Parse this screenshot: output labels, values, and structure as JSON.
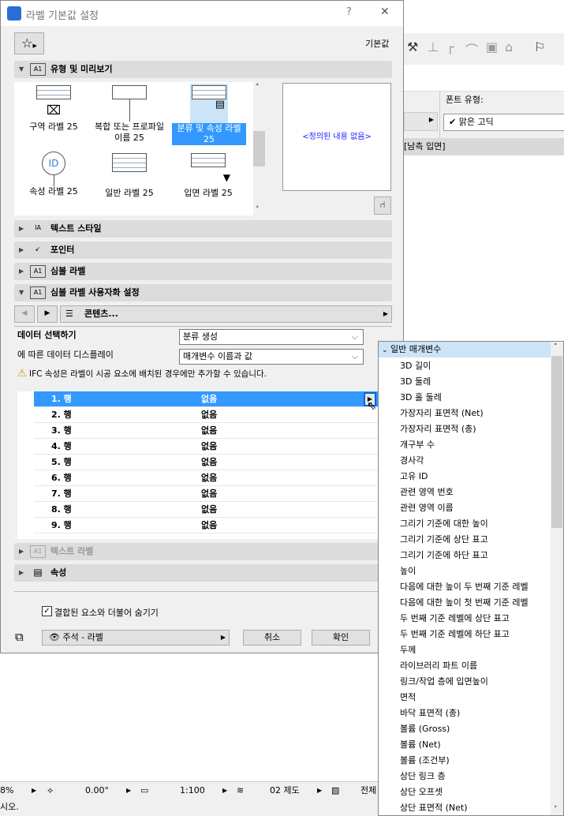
{
  "dialog": {
    "title": "라벨 기본값 설정",
    "help": "?",
    "close": "✕",
    "default_label": "기본값"
  },
  "sections": {
    "type_preview": "유형 및 미리보기",
    "text_style": "텍스트 스타일",
    "pointer": "포인터",
    "symbol_label": "심볼 라벨",
    "symbol_custom": "심볼 라벨 사용자화 설정",
    "text_label": "텍스트 라벨",
    "properties": "속성"
  },
  "label_types": [
    {
      "label": "구역 라벨 25"
    },
    {
      "label": "복합 또는 프로파일 이름 25"
    },
    {
      "label": "분류 및 속성 라벨 25",
      "selected": true
    },
    {
      "label": "속성 라벨 25"
    },
    {
      "label": "일반 라벨 25"
    },
    {
      "label": "입면 라벨 25"
    }
  ],
  "preview": {
    "empty": "<정의된 내용 없음>"
  },
  "nav": {
    "content": "콘텐츠..."
  },
  "data_select": {
    "label": "데이터 선택하기",
    "value": "분류 생성"
  },
  "data_display": {
    "label": "에 따른 데이터 디스플레이",
    "value": "매개변수 이름과 값"
  },
  "warning": "IFC 속성은 라벨이 시공 요소에 배치된 경우에만 추가할 수 있습니다.",
  "rows": [
    {
      "n": "1. 행",
      "v": "없음"
    },
    {
      "n": "2. 행",
      "v": "없음"
    },
    {
      "n": "3. 행",
      "v": "없음"
    },
    {
      "n": "4. 행",
      "v": "없음"
    },
    {
      "n": "5. 행",
      "v": "없음"
    },
    {
      "n": "6. 행",
      "v": "없음"
    },
    {
      "n": "7. 행",
      "v": "없음"
    },
    {
      "n": "8. 행",
      "v": "없음"
    },
    {
      "n": "9. 행",
      "v": "없음"
    }
  ],
  "footer": {
    "hide_checkbox": "결합된 요소와 더불어 숨기기",
    "layer": "주석 - 라벨",
    "cancel": "취소",
    "ok": "확인"
  },
  "background": {
    "font_type_label": "폰트 유형:",
    "font_value": "맑은 고딕",
    "view_name": "[남측 입면]"
  },
  "status": {
    "zoom": "8%",
    "angle": "0.00°",
    "scale": "1:100",
    "layer_combo": "02 제도",
    "all": "전체",
    "hint": "시오."
  },
  "param_list": {
    "header": "일반 매개변수",
    "items": [
      "3D 길이",
      "3D 둘레",
      "3D 홀 둘레",
      "가장자리 표면적 (Net)",
      "가장자리 표면적 (총)",
      "개구부 수",
      "경사각",
      "고유 ID",
      "관련 영역 번호",
      "관련 영역 이름",
      "그리기 기준에 대한  높이",
      "그리기 기준에 상단 표고",
      "그리기 기준에 하단 표고",
      "높이",
      "다음에 대한 높이 두 번째 기준 레벨",
      "다음에 대한 높이 첫 번째 기준 레벨",
      "두 번째 기준 레벨에 상단 표고",
      "두 번째 기준 레벨에 하단 표고",
      "두께",
      "라이브러리 파트 이름",
      "링크/작업 층에 입면높이",
      "면적",
      "바닥 표면적 (총)",
      "볼륨 (Gross)",
      "볼륨 (Net)",
      "볼륨 (조건부)",
      "상단 링크 층",
      "상단 오프셋",
      "상단 표면적 (Net)"
    ]
  }
}
